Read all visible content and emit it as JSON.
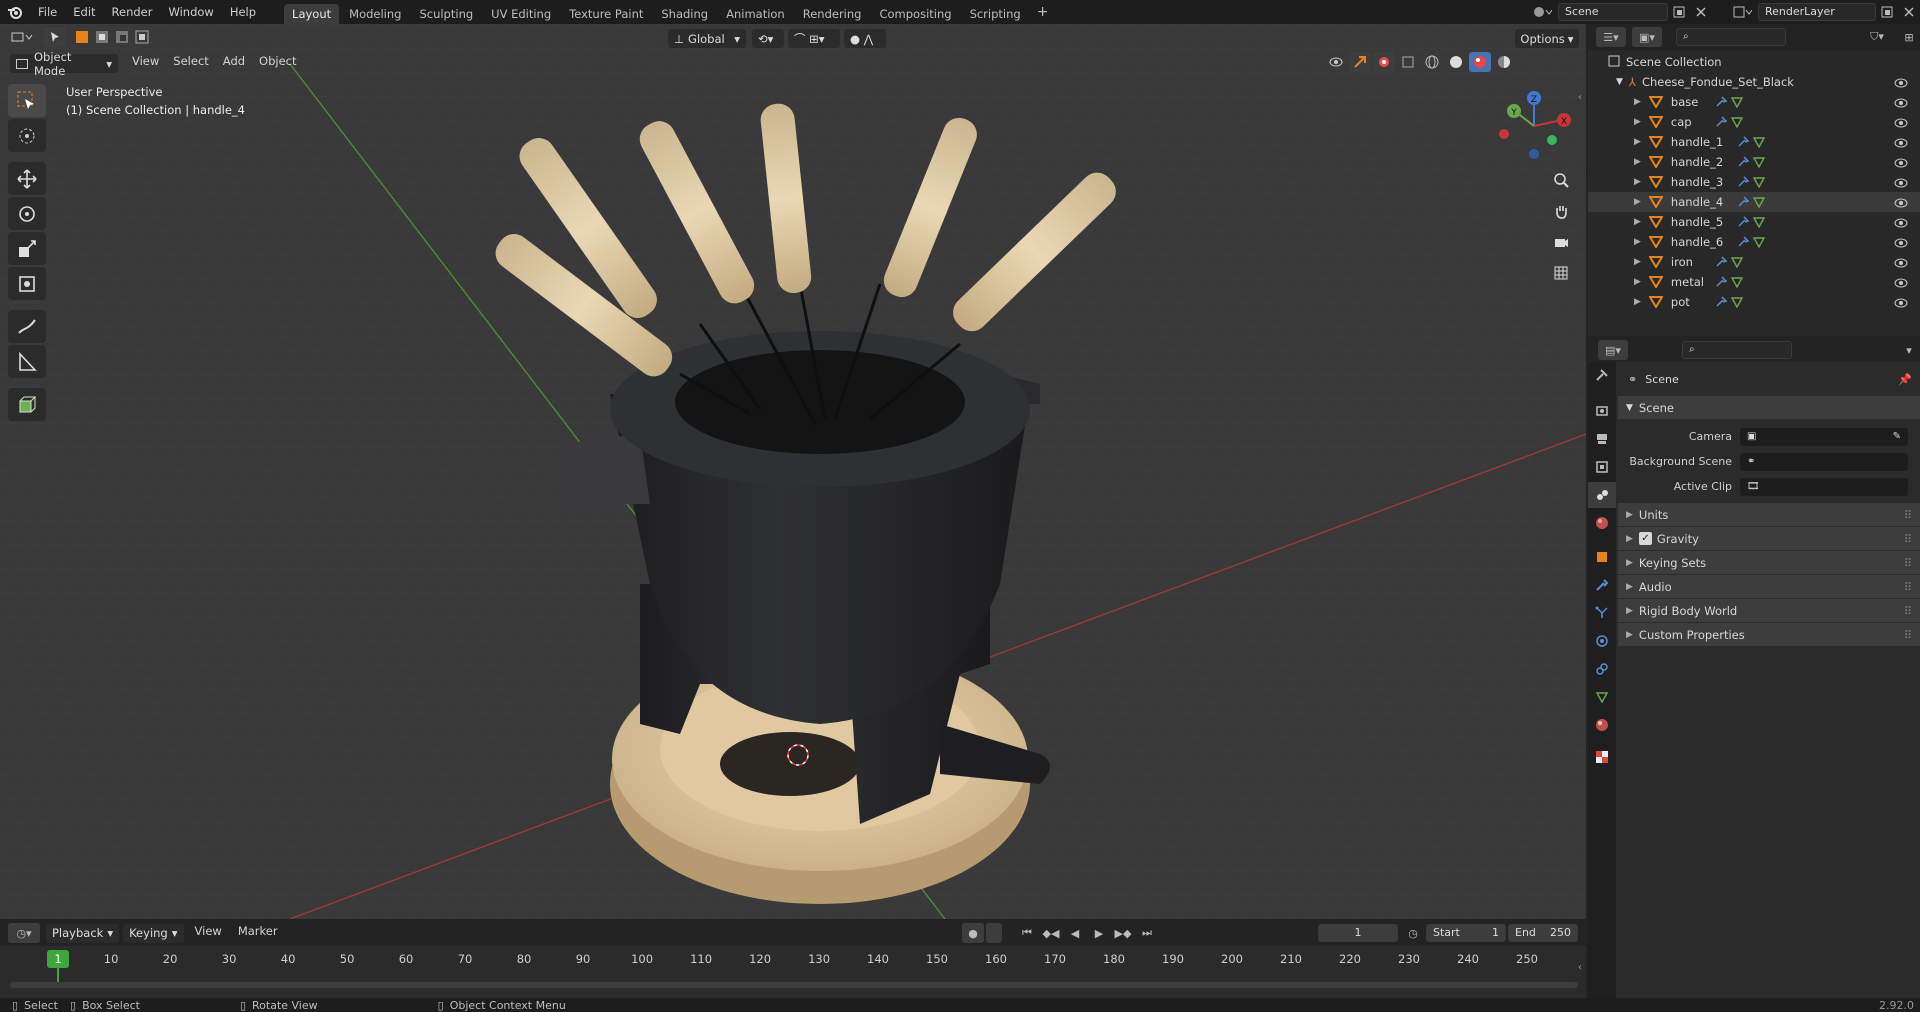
{
  "topbar": {
    "menus": [
      "File",
      "Edit",
      "Render",
      "Window",
      "Help"
    ],
    "workspaces": [
      "Layout",
      "Modeling",
      "Sculpting",
      "UV Editing",
      "Texture Paint",
      "Shading",
      "Animation",
      "Rendering",
      "Compositing",
      "Scripting"
    ],
    "active_workspace": "Layout",
    "add_tab": "+",
    "scene_name": "Scene",
    "view_layer": "RenderLayer"
  },
  "viewport": {
    "mode": "Object Mode",
    "menus": [
      "View",
      "Select",
      "Add",
      "Object"
    ],
    "transform_orientation": "Global",
    "options_label": "Options",
    "overlay_line1": "User Perspective",
    "overlay_line2": "(1) Scene Collection | handle_4",
    "gizmo": {
      "x": "X",
      "y": "Y",
      "z": "Z"
    }
  },
  "outliner": {
    "root": "Scene Collection",
    "collection": "Cheese_Fondue_Set_Black",
    "objects": [
      "base",
      "cap",
      "handle_1",
      "handle_2",
      "handle_3",
      "handle_4",
      "handle_5",
      "handle_6",
      "iron",
      "metal",
      "pot"
    ],
    "selected": "handle_4"
  },
  "properties": {
    "context": "Scene",
    "panel_title": "Scene",
    "fields": [
      {
        "label": "Camera",
        "value": ""
      },
      {
        "label": "Background Scene",
        "value": ""
      },
      {
        "label": "Active Clip",
        "value": ""
      }
    ],
    "subpanels": [
      "Units",
      "Gravity",
      "Keying Sets",
      "Audio",
      "Rigid Body World",
      "Custom Properties"
    ],
    "gravity_checked": true
  },
  "timeline": {
    "menus": [
      "Playback",
      "Keying",
      "View",
      "Marker"
    ],
    "current_frame": "1",
    "start_label": "Start",
    "start": "1",
    "end_label": "End",
    "end": "250",
    "ticks": [
      "1",
      "10",
      "20",
      "30",
      "40",
      "50",
      "60",
      "70",
      "80",
      "90",
      "100",
      "110",
      "120",
      "130",
      "140",
      "150",
      "160",
      "170",
      "180",
      "190",
      "200",
      "210",
      "220",
      "230",
      "240",
      "250"
    ]
  },
  "statusbar": {
    "select": "Select",
    "box_select": "Box Select",
    "rotate_view": "Rotate View",
    "context_menu": "Object Context Menu",
    "version": "2.92.0"
  },
  "colors": {
    "accent_active": "#4772b3",
    "selection_orange": "#e8831a",
    "header_bg": "#1d1d1d",
    "viewport_bg": "#393939"
  }
}
